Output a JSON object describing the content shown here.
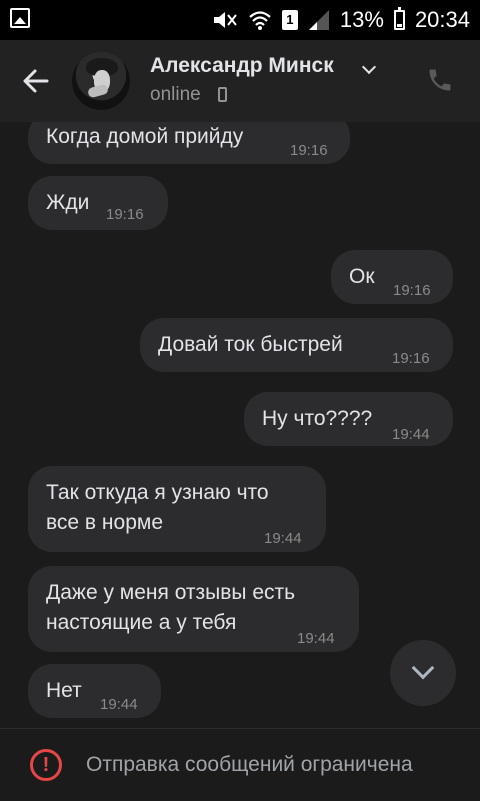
{
  "status_bar": {
    "battery_percent": "13%",
    "time": "20:34",
    "sim": "1"
  },
  "header": {
    "contact_name": "Александр Минск",
    "status": "online"
  },
  "messages": [
    {
      "direction": "incoming",
      "text": "Когда домой прийду",
      "time": "19:16"
    },
    {
      "direction": "incoming",
      "text": "Жди",
      "time": "19:16"
    },
    {
      "direction": "outgoing",
      "text": "Ок",
      "time": "19:16"
    },
    {
      "direction": "outgoing",
      "text": "Довай ток быстрей",
      "time": "19:16"
    },
    {
      "direction": "outgoing",
      "text": "Ну что????",
      "time": "19:44"
    },
    {
      "direction": "incoming",
      "text_line1": "Так откуда я узнаю что",
      "text_line2": "все в норме",
      "time": "19:44"
    },
    {
      "direction": "incoming",
      "text_line1": "Даже у меня отзывы есть",
      "text_line2": "настоящие а у тебя",
      "time": "19:44"
    },
    {
      "direction": "incoming",
      "text": "Нет",
      "time": "19:44"
    }
  ],
  "footer": {
    "restriction_text": "Отправка сообщений ограничена"
  },
  "colors": {
    "background": "#1b1b1c",
    "bubble": "#2c2c2e",
    "warning": "#e64646"
  }
}
